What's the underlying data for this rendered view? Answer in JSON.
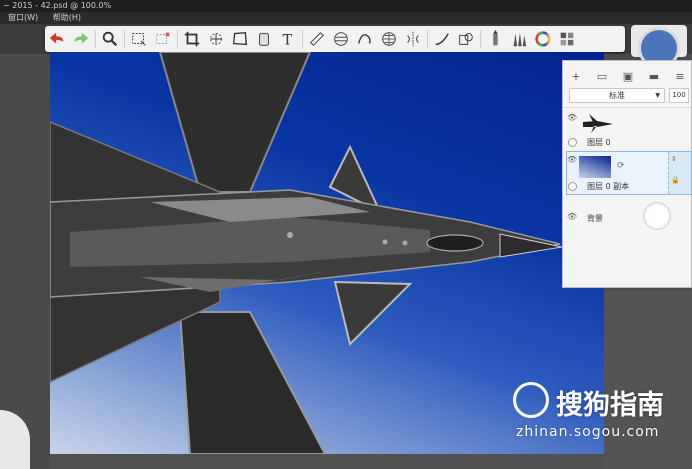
{
  "window_title": "~ 2015 - 42.psd @ 100.0%",
  "menu": {
    "items": [
      "窗口(W)",
      "帮助(H)"
    ]
  },
  "toolbar": {
    "tools": [
      "undo-icon",
      "redo-icon",
      "magnifier-icon",
      "rect-select-icon",
      "lasso-select-icon",
      "crop-icon",
      "transform-icon",
      "distort-icon",
      "fill-bucket-icon",
      "text-icon",
      "ruler-icon",
      "ellipse-guide-icon",
      "french-curve-icon",
      "perspective-icon",
      "symmetry-icon",
      "stroke-icon",
      "copy-paste-icon",
      "marker-icon",
      "brush-library-icon",
      "color-wheel-icon",
      "swatches-icon"
    ]
  },
  "layers_panel": {
    "blend_mode": "标准",
    "opacity": "100",
    "layers": [
      {
        "name": "图层 0",
        "selected": false
      },
      {
        "name": "图层 0 副本",
        "selected": true
      },
      {
        "name": "背景",
        "selected": false
      }
    ]
  },
  "watermark": {
    "text": "搜狗指南",
    "url": "zhinan.sogou.com"
  },
  "colors": {
    "canvas_top": "#04238f",
    "canvas_bottom": "#c9d5ea",
    "toolbar_bg": "#f2f2f2",
    "panel_bg": "#f4f4f4",
    "undo_red": "#d03a2a",
    "redo_green": "#7cc46a"
  }
}
